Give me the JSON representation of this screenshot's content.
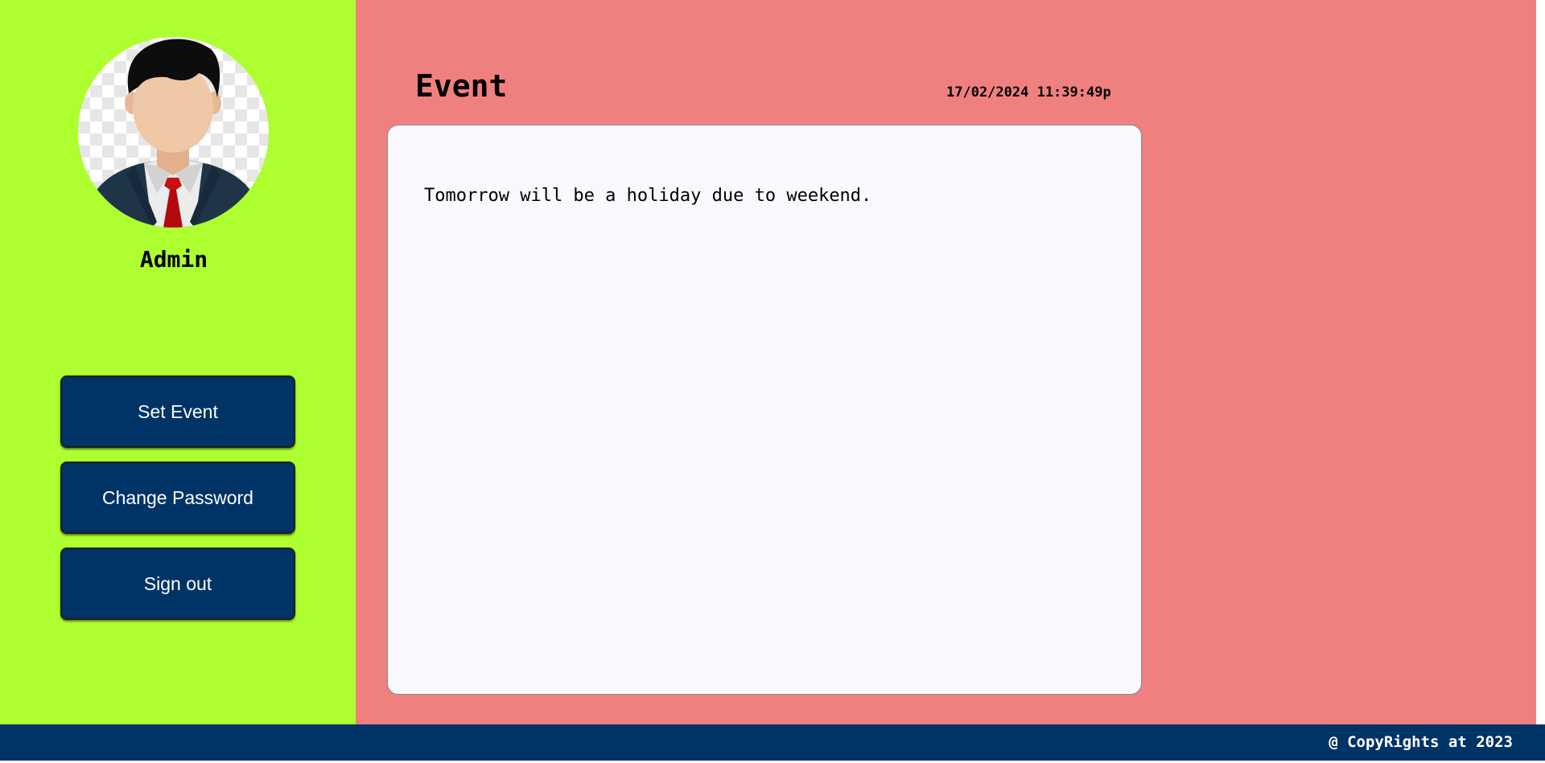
{
  "sidebar": {
    "user_name": "Admin",
    "buttons": [
      {
        "label": "Set Event"
      },
      {
        "label": "Change Password"
      },
      {
        "label": "Sign out"
      }
    ]
  },
  "main": {
    "title": "Event",
    "datetime": "17/02/2024 11:39:49p",
    "event_message": "Tomorrow will be a holiday due to weekend."
  },
  "footer": {
    "text": "@ CopyRights at 2023"
  },
  "colors": {
    "sidebar_bg": "#adff2f",
    "main_bg": "#f08080",
    "button_bg": "#003366",
    "footer_bg": "#003366",
    "card_bg": "#f8f8ff"
  }
}
